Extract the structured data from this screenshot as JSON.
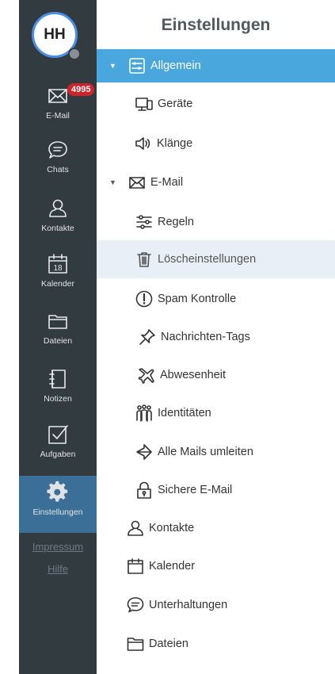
{
  "user": {
    "initials": "HH"
  },
  "rail": {
    "badge": "4995",
    "items": [
      {
        "label": "E-Mail",
        "icon": "mail-icon"
      },
      {
        "label": "Chats",
        "icon": "chat-icon"
      },
      {
        "label": "Kontakte",
        "icon": "contacts-icon"
      },
      {
        "label": "Kalender",
        "icon": "calendar-icon",
        "day": "18"
      },
      {
        "label": "Dateien",
        "icon": "folder-icon"
      },
      {
        "label": "Notizen",
        "icon": "notes-icon"
      },
      {
        "label": "Aufgaben",
        "icon": "tasks-icon"
      },
      {
        "label": "Einstellungen",
        "icon": "gear-icon"
      }
    ],
    "links": {
      "impressum": "Impressum",
      "hilfe": "Hilfe"
    }
  },
  "panel": {
    "title": "Einstellungen",
    "items": [
      {
        "label": "Allgemein",
        "icon": "general-settings-icon",
        "expanded": true,
        "selected": true
      },
      {
        "label": "Geräte",
        "icon": "devices-icon"
      },
      {
        "label": "Klänge",
        "icon": "speaker-icon"
      },
      {
        "label": "E-Mail",
        "icon": "mail-icon",
        "expanded": true
      },
      {
        "label": "Regeln",
        "icon": "rules-icon"
      },
      {
        "label": "Löscheinstellungen",
        "icon": "trash-icon"
      },
      {
        "label": "Spam Kontrolle",
        "icon": "alert-icon"
      },
      {
        "label": "Nachrichten-Tags",
        "icon": "pin-icon"
      },
      {
        "label": "Abwesenheit",
        "icon": "plane-icon"
      },
      {
        "label": "Identitäten",
        "icon": "identities-icon"
      },
      {
        "label": "Alle Mails umleiten",
        "icon": "redirect-icon"
      },
      {
        "label": "Sichere E-Mail",
        "icon": "lock-icon"
      },
      {
        "label": "Kontakte",
        "icon": "contacts-icon"
      },
      {
        "label": "Kalender",
        "icon": "calendar-icon"
      },
      {
        "label": "Unterhaltungen",
        "icon": "chat-icon"
      },
      {
        "label": "Dateien",
        "icon": "folder-icon"
      }
    ]
  },
  "colors": {
    "rail": "#323b40",
    "active": "#3b6f97",
    "selected": "#4aa7dd",
    "badge": "#d0222a"
  }
}
